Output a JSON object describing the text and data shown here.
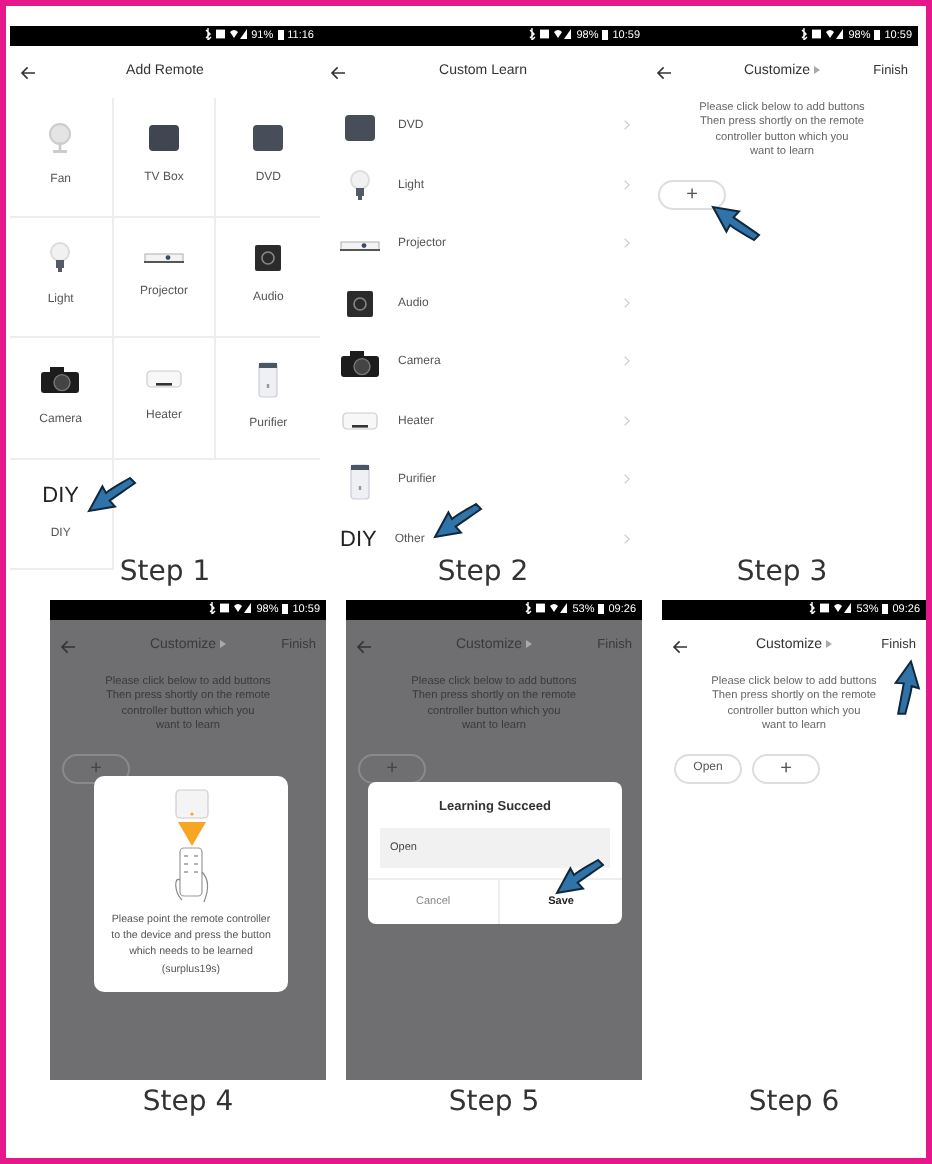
{
  "panels": [
    {
      "kind": "grid",
      "dimmed": false,
      "status": {
        "battery": "91%",
        "time": "11:16"
      },
      "title": "Add Remote",
      "items": [
        {
          "label": "Fan",
          "kind": "fan"
        },
        {
          "label": "TV Box",
          "kind": "tv"
        },
        {
          "label": "DVD",
          "kind": "dvd"
        },
        {
          "label": "Light",
          "kind": "light"
        },
        {
          "label": "Projector",
          "kind": "projector"
        },
        {
          "label": "Audio",
          "kind": "audio"
        },
        {
          "label": "Camera",
          "kind": "camera"
        },
        {
          "label": "Heater",
          "kind": "heater"
        },
        {
          "label": "Purifier",
          "kind": "purifier"
        },
        {
          "label": "DIY",
          "kind": "diy",
          "icon_text": "DIY",
          "pointed_at": true
        }
      ],
      "caption": "Step 1"
    },
    {
      "kind": "list",
      "dimmed": false,
      "status": {
        "battery": "98%",
        "time": "10:59"
      },
      "title": "Custom Learn",
      "items": [
        {
          "label": "DVD",
          "kind": "dvd"
        },
        {
          "label": "Light",
          "kind": "light"
        },
        {
          "label": "Projector",
          "kind": "projector"
        },
        {
          "label": "Audio",
          "kind": "audio"
        },
        {
          "label": "Camera",
          "kind": "camera"
        },
        {
          "label": "Heater",
          "kind": "heater"
        },
        {
          "label": "Purifier",
          "kind": "purifier"
        },
        {
          "label": "Other",
          "kind": "diy",
          "icon_text": "DIY",
          "pointed_at": true
        }
      ],
      "caption": "Step 2"
    },
    {
      "kind": "customize",
      "dimmed": false,
      "status": {
        "battery": "98%",
        "time": "10:59"
      },
      "title": "Customize",
      "action": {
        "label": "Finish"
      },
      "hint": "Please click below to add buttons\nThen press shortly on the remote\ncontroller button which you\nwant to learn",
      "buttons": [
        {
          "label": "+",
          "pointed_at": true
        }
      ],
      "caption": "Step 3"
    },
    {
      "kind": "customize",
      "dimmed": true,
      "status": {
        "battery": "98%",
        "time": "10:59"
      },
      "title": "Customize",
      "action": {
        "label": "Finish"
      },
      "hint": "Please click below to add buttons\nThen press shortly on the remote\ncontroller button which you\nwant to learn",
      "buttons": [
        {
          "label": "+"
        }
      ],
      "modal": {
        "kind": "learning",
        "message": "Please point the remote controller to the device and press the button which needs to be learned (surplus19s)"
      },
      "caption": "Step 4"
    },
    {
      "kind": "customize",
      "dimmed": true,
      "status": {
        "battery": "53%",
        "time": "09:26"
      },
      "title": "Customize",
      "action": {
        "label": "Finish"
      },
      "hint": "Please click below to add buttons\nThen press shortly on the remote\ncontroller button which you\nwant to learn",
      "buttons": [
        {
          "label": "+"
        }
      ],
      "modal": {
        "kind": "result",
        "title": "Learning Succeed",
        "value": "Open",
        "buttons": [
          {
            "label": "Cancel",
            "primary": false
          },
          {
            "label": "Save",
            "primary": true,
            "pointed_at": true
          }
        ]
      },
      "caption": "Step 5"
    },
    {
      "kind": "customize",
      "dimmed": false,
      "status": {
        "battery": "53%",
        "time": "09:26"
      },
      "title": "Customize",
      "action": {
        "label": "Finish",
        "pointed_at": true
      },
      "hint": "Please click below to add buttons\nThen press shortly on the remote\ncontroller button which you\nwant to learn",
      "buttons": [
        {
          "label": "Open"
        },
        {
          "label": "+"
        }
      ],
      "caption": "Step 6"
    }
  ]
}
